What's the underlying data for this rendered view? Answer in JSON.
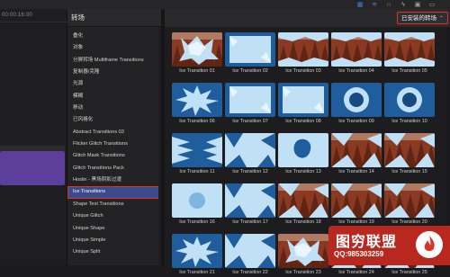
{
  "topbar": {
    "timecode": "00:00:16:00",
    "icons": [
      "network-icon",
      "equalizer-icon",
      "headphones-icon",
      "lightning-icon",
      "share-icon",
      "window-icon"
    ]
  },
  "sidebar": {
    "header": "转场",
    "items": [
      {
        "label": "叠化"
      },
      {
        "label": "对象"
      },
      {
        "label": "分屏转场 Multiframe Transitions"
      },
      {
        "label": "复制器/克隆"
      },
      {
        "label": "光源"
      },
      {
        "label": "模糊"
      },
      {
        "label": "移动"
      },
      {
        "label": "已风格化"
      },
      {
        "label": "Abstract Transitions 03"
      },
      {
        "label": "Flicker Glitch Transitions"
      },
      {
        "label": "Glitch Mask Transitions"
      },
      {
        "label": "Glitch Transitions Pack"
      },
      {
        "label": "Hoslin - 黑场阴影过渡"
      },
      {
        "label": "Ice Transitions",
        "selected": true
      },
      {
        "label": "Shape Text Transitions"
      },
      {
        "label": "Unique Glitch"
      },
      {
        "label": "Unique Shape"
      },
      {
        "label": "Unique Simple"
      },
      {
        "label": "Unique Split"
      }
    ]
  },
  "browser": {
    "filter_dropdown": "已安装的转场",
    "tiles": [
      {
        "label": "Ice Transition 01",
        "style": "forest-spikes"
      },
      {
        "label": "Ice Transition 02",
        "style": "frame-plain"
      },
      {
        "label": "Ice Transition 03",
        "style": "frame-forest"
      },
      {
        "label": "Ice Transition 04",
        "style": "frame-forest"
      },
      {
        "label": "Ice Transition 05",
        "style": "frame-forest"
      },
      {
        "label": "Ice Transition 06",
        "style": "burst"
      },
      {
        "label": "Ice Transition 07",
        "style": "frame-plain"
      },
      {
        "label": "Ice Transition 08",
        "style": "frame-plain"
      },
      {
        "label": "Ice Transition 09",
        "style": "ring"
      },
      {
        "label": "Ice Transition 10",
        "style": "ring"
      },
      {
        "label": "Ice Transition 11",
        "style": "spiky-left"
      },
      {
        "label": "Ice Transition 12",
        "style": "shards"
      },
      {
        "label": "Ice Transition 13",
        "style": "blob"
      },
      {
        "label": "Ice Transition 14",
        "style": "forest-shards"
      },
      {
        "label": "Ice Transition 15",
        "style": "forest-shards"
      },
      {
        "label": "Ice Transition 16",
        "style": "plain-ice"
      },
      {
        "label": "Ice Transition 17",
        "style": "shards"
      },
      {
        "label": "Ice Transition 18",
        "style": "forest-shards"
      },
      {
        "label": "Ice Transition 19",
        "style": "forest-shards"
      },
      {
        "label": "Ice Transition 20",
        "style": "forest-shards"
      },
      {
        "label": "Ice Transition 21",
        "style": "burst"
      },
      {
        "label": "Ice Transition 22",
        "style": "shards"
      },
      {
        "label": "Ice Transition 23",
        "style": "forest-spikes"
      },
      {
        "label": "Ice Transition 24",
        "style": "forest-shards"
      },
      {
        "label": "Ice Transition 25",
        "style": "forest-shards"
      }
    ]
  },
  "watermark": {
    "title": "图穷联盟",
    "qq": "QQ:985303259"
  },
  "colors": {
    "ice": "#bfe0f5",
    "forest": "#8a3a22",
    "dark_blue": "#1f5d9c",
    "selection": "#3a4a8a",
    "highlight_outline": "#e0302a"
  }
}
